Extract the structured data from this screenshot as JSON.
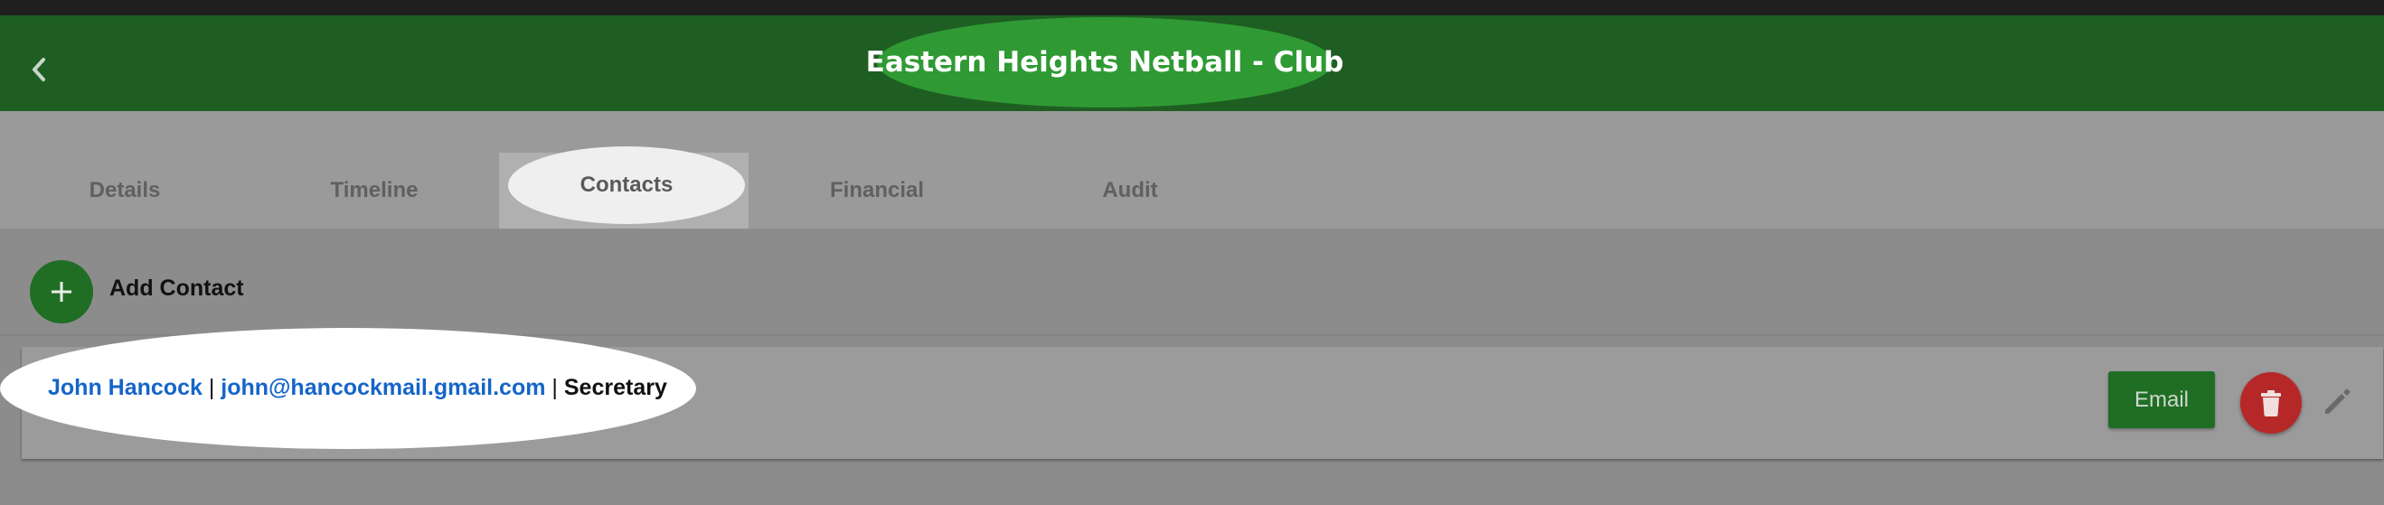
{
  "header": {
    "title": "Eastern Heights Netball - Club",
    "back_icon": "chevron-left-icon"
  },
  "tabs": [
    {
      "label": "Details",
      "active": false
    },
    {
      "label": "Timeline",
      "active": false
    },
    {
      "label": "Contacts",
      "active": true
    },
    {
      "label": "Financial",
      "active": false
    },
    {
      "label": "Audit",
      "active": false
    }
  ],
  "actions": {
    "add_contact_label": "Add Contact",
    "add_icon": "plus-icon"
  },
  "contacts": [
    {
      "name": "John Hancock",
      "email": "john@hancockmail.gmail.com",
      "role": "Secretary",
      "separator": "|",
      "email_button_label": "Email",
      "delete_icon": "trash-icon",
      "edit_icon": "pencil-icon"
    }
  ],
  "colors": {
    "header_bg": "#1f5e22",
    "title_highlight": "#2f9a34",
    "accent_green": "#1f6e24",
    "link_blue": "#1565c8",
    "delete_red": "#b62828"
  }
}
